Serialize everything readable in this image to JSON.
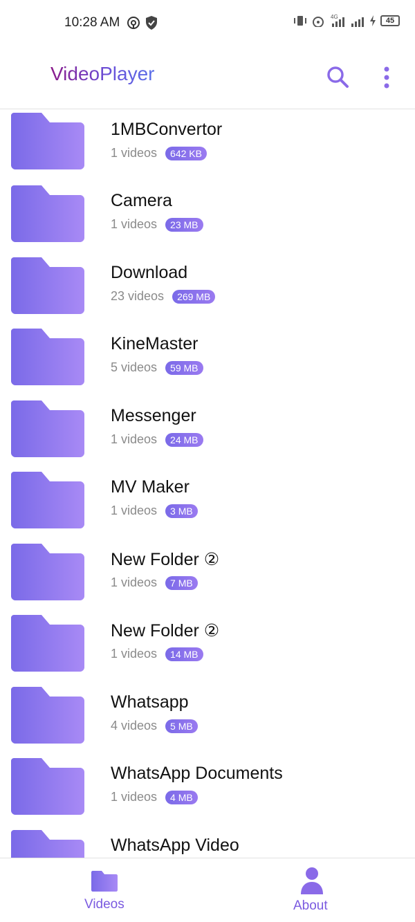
{
  "status_bar": {
    "time": "10:28 AM",
    "battery": "45"
  },
  "app_bar": {
    "title": "VideoPlayer",
    "search_icon": "search-icon",
    "more_icon": "more-vert-icon"
  },
  "colors": {
    "accent": "#7a6ae8",
    "accent_light": "#a88af5",
    "title_start": "#8a1a8a",
    "title_end": "#5a6fe8",
    "label": "#7a5ae0"
  },
  "folders": [
    {
      "name": "1MBConvertor",
      "count": "1 videos",
      "size": "642 KB"
    },
    {
      "name": "Camera",
      "count": "1 videos",
      "size": "23 MB"
    },
    {
      "name": "Download",
      "count": "23 videos",
      "size": "269 MB"
    },
    {
      "name": "KineMaster",
      "count": "5 videos",
      "size": "59 MB"
    },
    {
      "name": "Messenger",
      "count": "1 videos",
      "size": "24 MB"
    },
    {
      "name": "MV Maker",
      "count": "1 videos",
      "size": "3 MB"
    },
    {
      "name": "New Folder ②",
      "count": "1 videos",
      "size": "7 MB"
    },
    {
      "name": "New Folder ②",
      "count": "1 videos",
      "size": "14 MB"
    },
    {
      "name": "Whatsapp",
      "count": "4 videos",
      "size": "5 MB"
    },
    {
      "name": "WhatsApp Documents",
      "count": "1 videos",
      "size": "4 MB"
    },
    {
      "name": "WhatsApp Video",
      "count": "",
      "size": ""
    }
  ],
  "bottom_nav": {
    "videos_label": "Videos",
    "about_label": "About"
  }
}
